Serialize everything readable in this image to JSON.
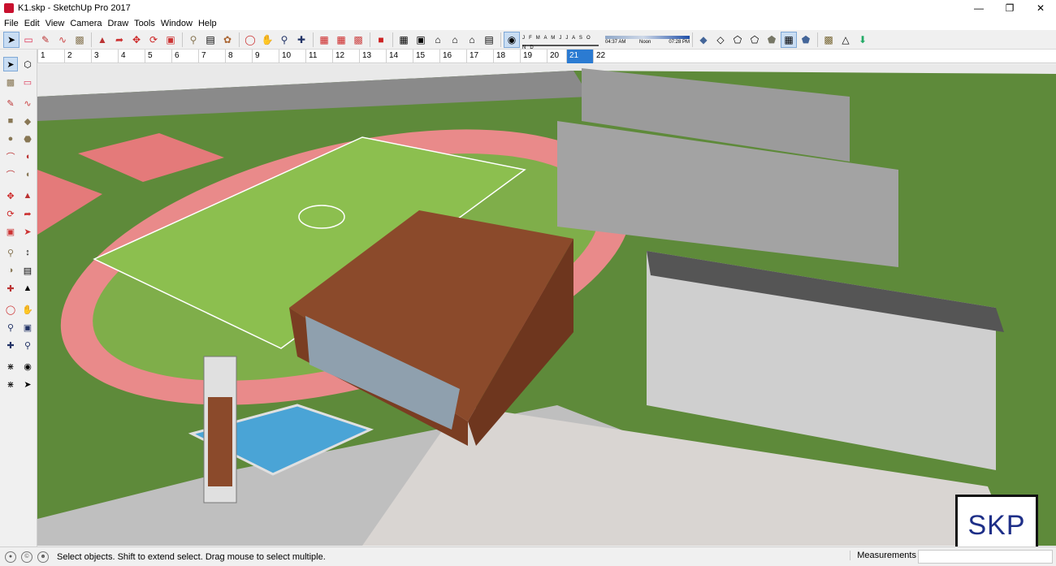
{
  "window": {
    "title": "K1.skp - SketchUp Pro 2017"
  },
  "menu": [
    "File",
    "Edit",
    "View",
    "Camera",
    "Draw",
    "Tools",
    "Window",
    "Help"
  ],
  "shadow": {
    "months": "J F M A M J J A S O N D",
    "time_start": "04:37 AM",
    "time_noon": "Noon",
    "time_end": "07:28 PM"
  },
  "scenes": [
    "1",
    "2",
    "3",
    "4",
    "5",
    "6",
    "7",
    "8",
    "9",
    "10",
    "11",
    "12",
    "13",
    "14",
    "15",
    "16",
    "17",
    "18",
    "19",
    "20",
    "21",
    "22"
  ],
  "active_scene": "21",
  "status": {
    "message": "Select objects. Shift to extend select. Drag mouse to select multiple.",
    "measurements_label": "Measurements",
    "measurements_value": ""
  },
  "watermark": {
    "text": "SKP"
  },
  "icons": {
    "toolbar": [
      "select-icon",
      "eraser-icon",
      "pencil-icon",
      "freehand-icon",
      "paint-bucket-icon",
      "push-pull-icon",
      "follow-me-icon",
      "move-icon",
      "rotate-icon",
      "scale-icon",
      "tape-measure-icon",
      "text-icon",
      "paint-icon",
      "orbit-icon",
      "pan-icon",
      "zoom-icon",
      "zoom-extents-icon",
      "3d-warehouse-icon",
      "extension-warehouse-icon",
      "layout-icon",
      "styles-icon",
      "iso-view-icon",
      "top-view-icon",
      "front-view-icon",
      "right-view-icon",
      "back-view-icon",
      "left-view-icon",
      "shadows-icon",
      "xray-icon",
      "back-edges-icon",
      "wireframe-icon",
      "hidden-line-icon",
      "shaded-icon",
      "shaded-textures-icon",
      "monochrome-icon",
      "section-plane-icon",
      "section-display-icon",
      "section-cuts-icon"
    ],
    "left": [
      "select-icon",
      "make-component-icon",
      "paint-bucket-icon",
      "eraser-icon",
      "line-icon",
      "freehand-icon",
      "rectangle-icon",
      "rotated-rectangle-icon",
      "circle-icon",
      "polygon-icon",
      "arc-icon",
      "pie-icon",
      "two-point-arc-icon",
      "three-point-arc-icon",
      "move-icon",
      "push-pull-icon",
      "rotate-icon",
      "follow-me-icon",
      "scale-icon",
      "offset-icon",
      "tape-measure-icon",
      "dimension-icon",
      "protractor-icon",
      "text-icon",
      "axes-icon",
      "3d-text-icon",
      "orbit-icon",
      "pan-icon",
      "zoom-icon",
      "zoom-window-icon",
      "zoom-extents-icon",
      "previous-view-icon",
      "walk-icon",
      "look-around-icon",
      "position-camera-icon",
      "section-plane-icon"
    ]
  },
  "colors": {
    "accent": "#2b7bd2",
    "sky": "#ffffff",
    "grass": "#5e8a3a",
    "track": "#e98a8a"
  }
}
